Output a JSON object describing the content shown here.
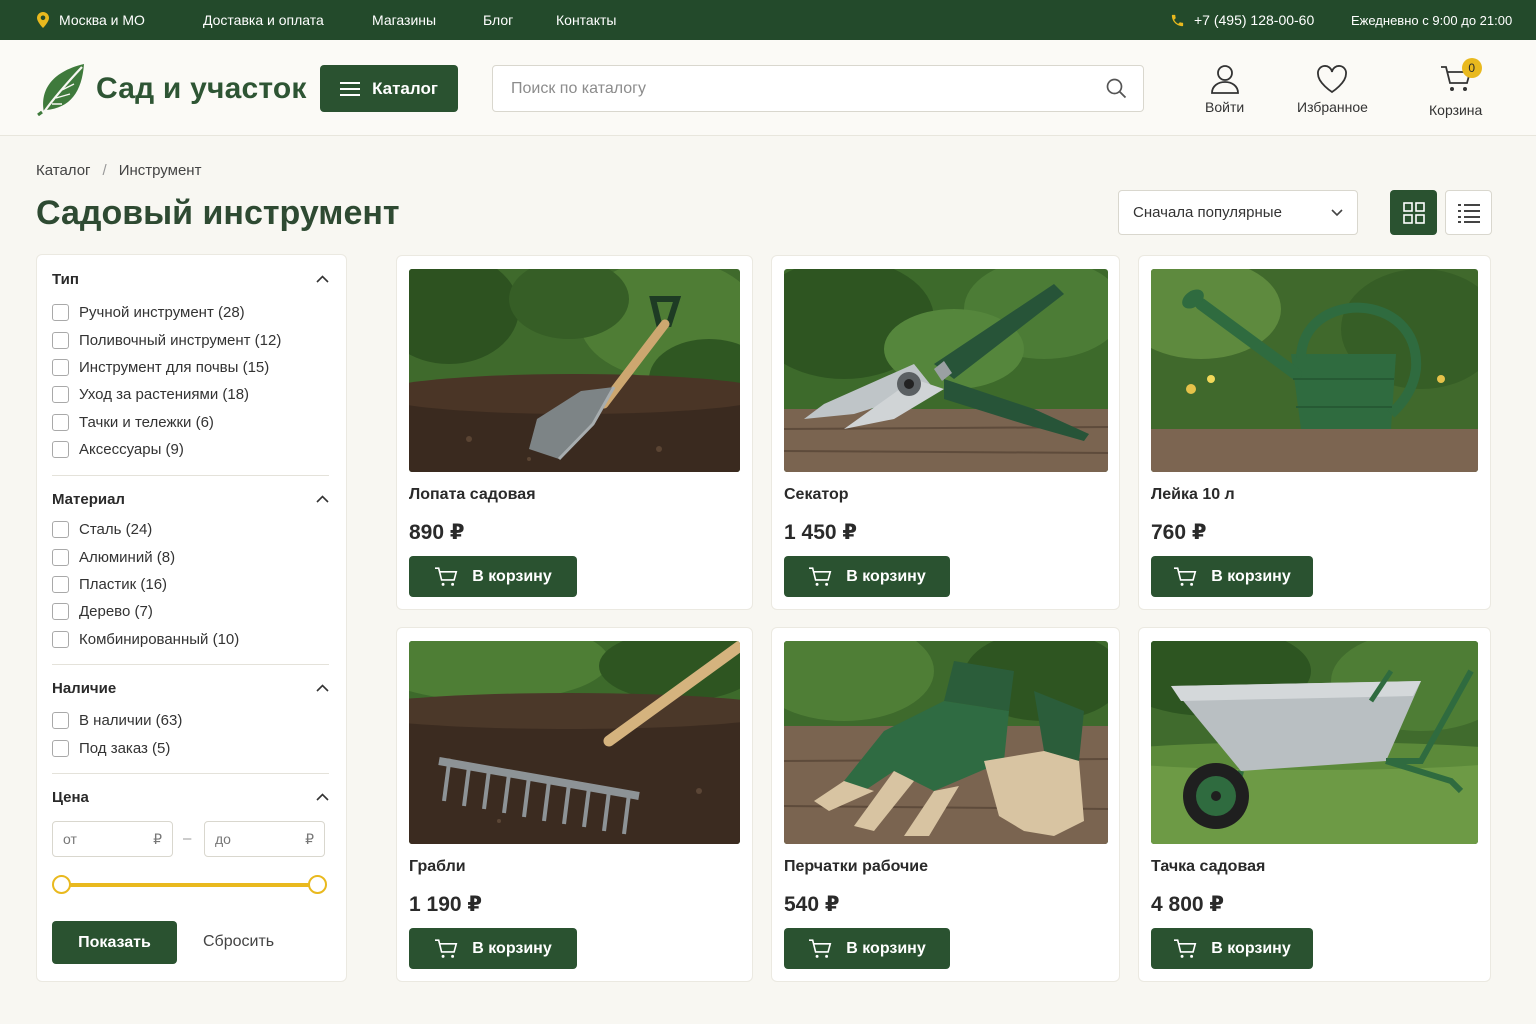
{
  "topbar": {
    "region": "Москва и МО",
    "nav": [
      "Доставка и оплата",
      "Магазины",
      "Блог",
      "Контакты"
    ],
    "phone": "+7 (495) 128-00-60",
    "hours": "Ежедневно с 9:00 до 21:00"
  },
  "header": {
    "logo_text": "Сад и участок",
    "catalog_label": "Каталог",
    "search_placeholder": "Поиск по каталогу",
    "login_label": "Войти",
    "favorites_label": "Избранное",
    "cart_label": "Корзина",
    "cart_count": "0"
  },
  "breadcrumb": {
    "items": [
      "Каталог",
      "Инструмент"
    ],
    "separator": "/"
  },
  "page_title": "Садовый инструмент",
  "sort": {
    "selected": "Сначала популярные"
  },
  "filters": {
    "type": {
      "title": "Тип",
      "options": [
        "Ручной инструмент (28)",
        "Поливочный инструмент (12)",
        "Инструмент для почвы (15)",
        "Уход за растениями (18)",
        "Тачки и тележки (6)",
        "Аксессуары (9)"
      ]
    },
    "material": {
      "title": "Материал",
      "options": [
        "Сталь (24)",
        "Алюминий (8)",
        "Пластик (16)",
        "Дерево (7)",
        "Комбинированный (10)"
      ]
    },
    "availability": {
      "title": "Наличие",
      "options": [
        "В наличии (63)",
        "Под заказ (5)"
      ]
    },
    "price": {
      "title": "Цена",
      "from_placeholder": "от",
      "to_placeholder": "до",
      "currency": "₽",
      "separator": "–"
    },
    "show_label": "Показать",
    "reset_label": "Сбросить"
  },
  "products": [
    {
      "name": "Лопата садовая",
      "price": "890 ₽",
      "buy_label": "В корзину"
    },
    {
      "name": "Секатор",
      "price": "1 450 ₽",
      "buy_label": "В корзину"
    },
    {
      "name": "Лейка 10 л",
      "price": "760 ₽",
      "buy_label": "В корзину"
    },
    {
      "name": "Грабли",
      "price": "1 190 ₽",
      "buy_label": "В корзину"
    },
    {
      "name": "Перчатки рабочие",
      "price": "540 ₽",
      "buy_label": "В корзину"
    },
    {
      "name": "Тачка садовая",
      "price": "4 800 ₽",
      "buy_label": "В корзину"
    }
  ],
  "colors": {
    "primary_green": "#2a5230",
    "topbar_green": "#234a2b",
    "accent_yellow": "#e9b91e",
    "background": "#f8f7f2"
  }
}
